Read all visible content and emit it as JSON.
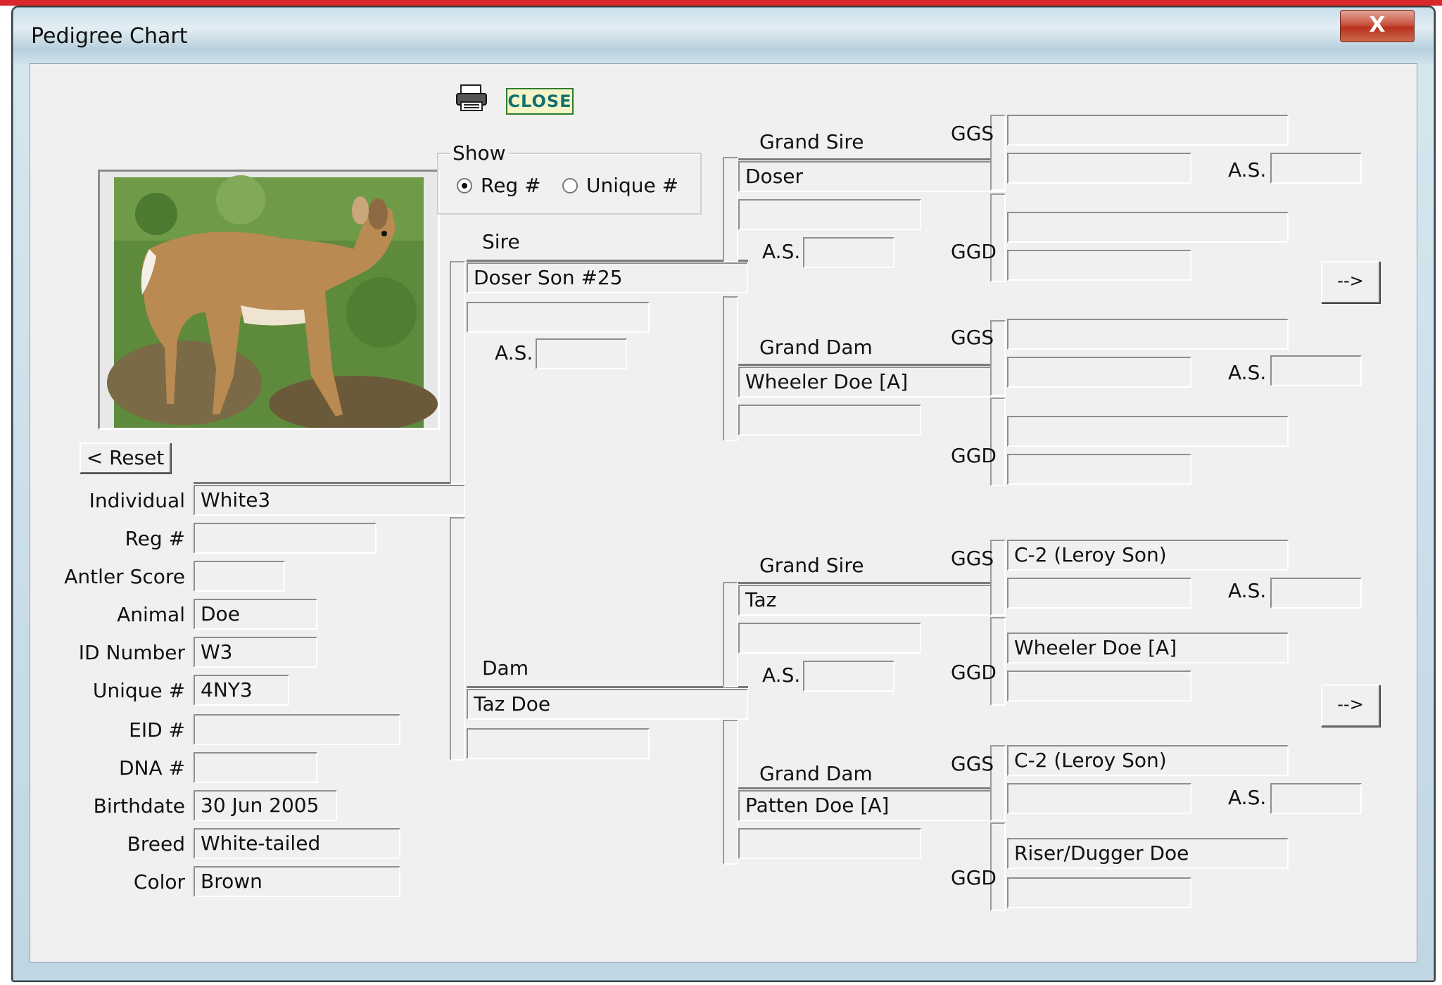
{
  "window": {
    "title": "Pedigree Chart",
    "close_glyph": "X"
  },
  "toolbar": {
    "close_label": "CLOSE",
    "print_icon": "printer-icon"
  },
  "show": {
    "legend": "Show",
    "reg_label": "Reg #",
    "unique_label": "Unique #",
    "selected": "Reg #"
  },
  "reset_label": "< Reset",
  "individual": {
    "labels": {
      "individual": "Individual",
      "reg": "Reg #",
      "antler": "Antler Score",
      "animal": "Animal",
      "id_number": "ID Number",
      "unique": "Unique #",
      "eid": "EID #",
      "dna": "DNA #",
      "birthdate": "Birthdate",
      "breed": "Breed",
      "color": "Color"
    },
    "values": {
      "individual": "White3",
      "reg": "",
      "antler": "",
      "animal": "Doe",
      "id_number": "W3",
      "unique": "4NY3",
      "eid": "",
      "dna": "",
      "birthdate": "30 Jun 2005",
      "breed": "White-tailed",
      "color": "Brown"
    }
  },
  "labels": {
    "sire": "Sire",
    "dam": "Dam",
    "grand_sire": "Grand Sire",
    "grand_dam": "Grand Dam",
    "ggs": "GGS",
    "ggd": "GGD",
    "as": "A.S."
  },
  "sire": {
    "name": "Doser Son #25",
    "reg": "",
    "as": ""
  },
  "dam": {
    "name": "Taz Doe",
    "reg": ""
  },
  "paternal": {
    "grand_sire": {
      "name": "Doser",
      "reg": "",
      "as": "",
      "ggs_name": "",
      "ggs_reg": "",
      "ggs_as": "",
      "ggd_name": "",
      "ggd_reg": ""
    },
    "grand_dam": {
      "name": "Wheeler Doe [A]",
      "reg": "",
      "ggs_name": "",
      "ggs_reg": "",
      "ggs_as": "",
      "ggd_name": "",
      "ggd_reg": ""
    }
  },
  "maternal": {
    "grand_sire": {
      "name": "Taz",
      "reg": "",
      "as": "",
      "ggs_name": "C-2 (Leroy Son)",
      "ggs_reg": "",
      "ggs_as": "",
      "ggd_name": "Wheeler Doe [A]",
      "ggd_reg": ""
    },
    "grand_dam": {
      "name": "Patten Doe [A]",
      "reg": "",
      "ggs_name": "C-2 (Leroy Son)",
      "ggs_reg": "",
      "ggs_as": "",
      "ggd_name": "Riser/Dugger Doe",
      "ggd_reg": ""
    }
  },
  "arrow_label": "-->"
}
